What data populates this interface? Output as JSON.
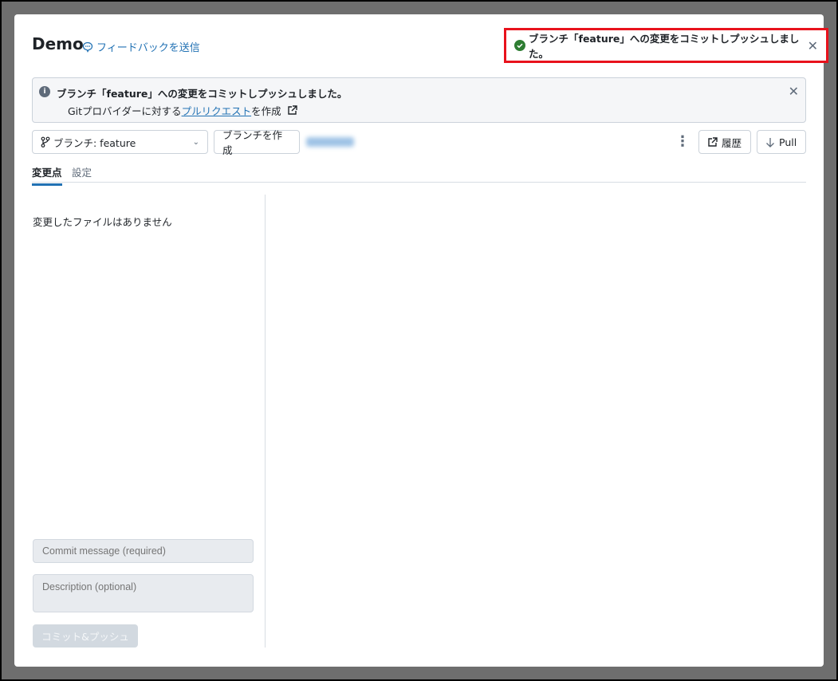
{
  "header": {
    "title": "Demo",
    "feedback_label": "フィードバックを送信"
  },
  "toast": {
    "message": "ブランチ「feature」への変更をコミットしプッシュしました。",
    "status_color": "#2e7d32"
  },
  "banner": {
    "title": "ブランチ「feature」への変更をコミットしプッシュしました。",
    "line2_prefix": "Gitプロバイダーに対する",
    "link": "プルリクエスト",
    "line2_suffix": "を作成"
  },
  "toolbar": {
    "branch_select": "ブランチ: feature",
    "create_branch": "ブランチを作成",
    "history": "履歴",
    "pull": "Pull"
  },
  "tabs": [
    {
      "label": "変更点"
    },
    {
      "label": "設定"
    }
  ],
  "changes": {
    "empty_text": "変更したファイルはありません",
    "commit_placeholder": "Commit message (required)",
    "description_placeholder": "Description (optional)",
    "commit_button": "コミット&プッシュ"
  }
}
